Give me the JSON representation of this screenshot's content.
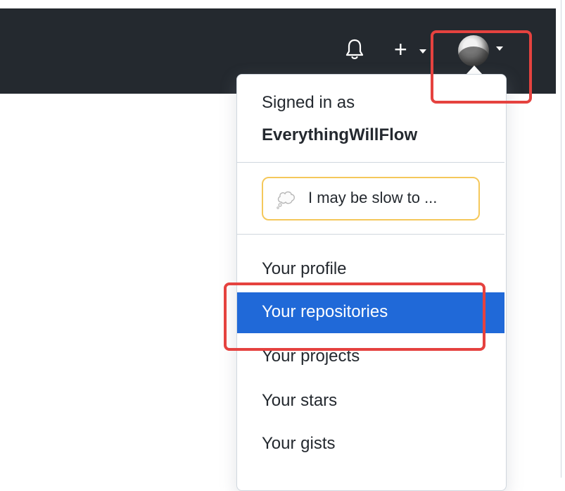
{
  "header": {
    "icons": [
      "bell-icon",
      "plus-icon",
      "chevron-down-icon",
      "avatar",
      "chevron-down-icon"
    ],
    "background": "#24292f"
  },
  "menu": {
    "signed_in_label": "Signed in as",
    "username": "EverythingWillFlow",
    "status_text": "I may be slow to ...",
    "items": [
      {
        "label": "Your profile"
      },
      {
        "label": "Your repositories",
        "highlighted": true
      },
      {
        "label": "Your projects"
      },
      {
        "label": "Your stars"
      },
      {
        "label": "Your gists"
      }
    ],
    "accent": "#2069d8",
    "highlight_box_color": "#e5423f"
  }
}
